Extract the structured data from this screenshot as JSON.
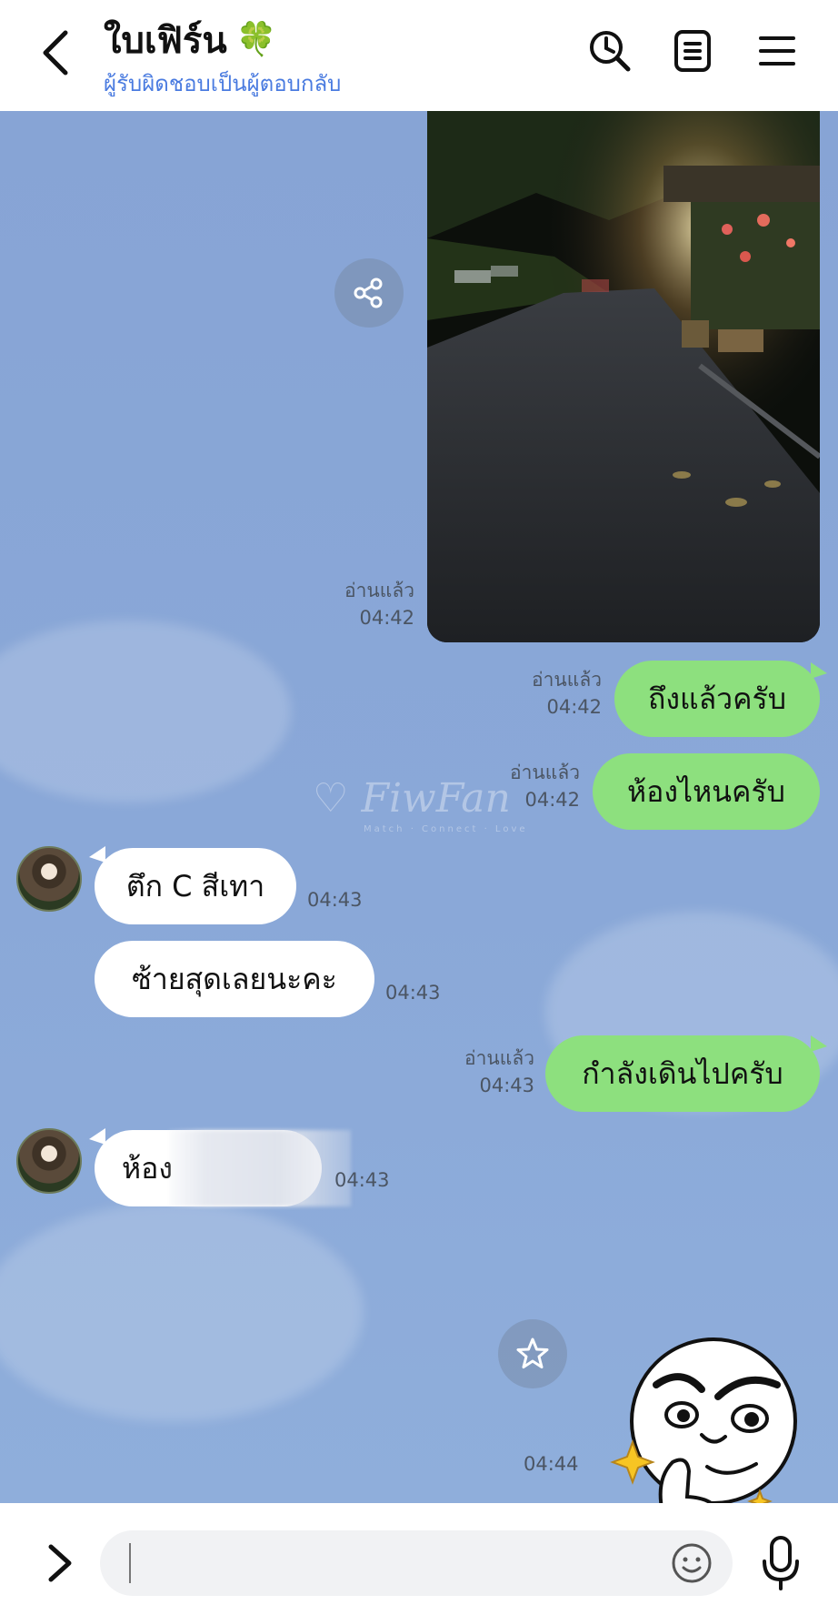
{
  "header": {
    "title": "ใบเฟิร์น",
    "title_emoji": "🍀",
    "subtitle": "ผู้รับผิดชอบเป็นผู้ตอบกลับ",
    "icons": [
      "back-icon",
      "clock-search-icon",
      "notes-icon",
      "menu-icon"
    ]
  },
  "watermark": {
    "text": "FiwFan",
    "sub": "Match · Connect · Love"
  },
  "messages": [
    {
      "type": "image",
      "side": "right",
      "read": "อ่านแล้ว",
      "time": "04:42"
    },
    {
      "type": "text",
      "side": "right",
      "text": "ถึงแล้วครับ",
      "read": "อ่านแล้ว",
      "time": "04:42"
    },
    {
      "type": "text",
      "side": "right",
      "text": "ห้องไหนครับ",
      "read": "อ่านแล้ว",
      "time": "04:42"
    },
    {
      "type": "text",
      "side": "left",
      "text": "ตึก C สีเทา",
      "time": "04:43"
    },
    {
      "type": "text",
      "side": "left",
      "text": "ซ้ายสุดเลยนะคะ",
      "time": "04:43"
    },
    {
      "type": "text",
      "side": "right",
      "text": "กำลังเดินไปครับ",
      "read": "อ่านแล้ว",
      "time": "04:43"
    },
    {
      "type": "text",
      "side": "left",
      "text": "ห้อง",
      "time": "04:43",
      "blurred": true
    },
    {
      "type": "sticker",
      "side": "right",
      "time": "04:44"
    }
  ],
  "input": {
    "placeholder": "",
    "icons": [
      "expand-icon",
      "emoji-icon",
      "mic-icon"
    ]
  }
}
